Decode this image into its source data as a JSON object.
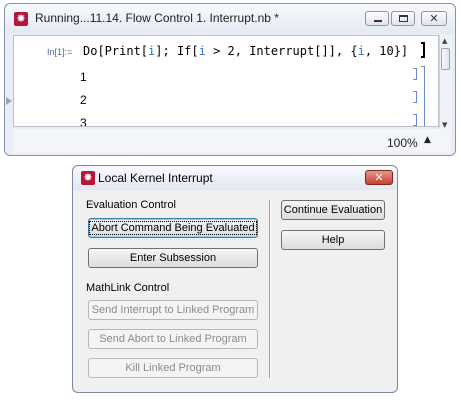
{
  "notebook": {
    "title": "Running...11.14. Flow Control 1. Interrupt.nb *",
    "icon": "mathematica-star-icon",
    "caption_buttons": {
      "close": "✕"
    },
    "input_label": "In[1]:=",
    "input_code": {
      "p1": "Do[Print[",
      "v1": "i",
      "p2": "]; If[",
      "v2": "i",
      "p3": " > 2, Interrupt[]], {",
      "v3": "i",
      "p4": ", 10}]"
    },
    "outputs": [
      "1",
      "2",
      "3"
    ],
    "zoom": "100%",
    "zoom_arrow": "▲"
  },
  "dialog": {
    "title": "Local Kernel Interrupt",
    "close_label": "✕",
    "evaluation_group_label": "Evaluation Control",
    "mathlink_group_label": "MathLink Control",
    "buttons": {
      "abort": "Abort Command Being Evaluated",
      "subsession": "Enter Subsession",
      "send_interrupt": "Send Interrupt to Linked Program",
      "send_abort": "Send Abort to Linked Program",
      "kill": "Kill Linked Program",
      "continue": "Continue Evaluation",
      "help": "Help"
    }
  },
  "colors": {
    "accent_icon": "#b5163a",
    "code_variable": "#3b6fbf",
    "input_label": "#4d6aa3",
    "close_button": "#c7412f",
    "cell_bracket": "#6a8cc7"
  }
}
